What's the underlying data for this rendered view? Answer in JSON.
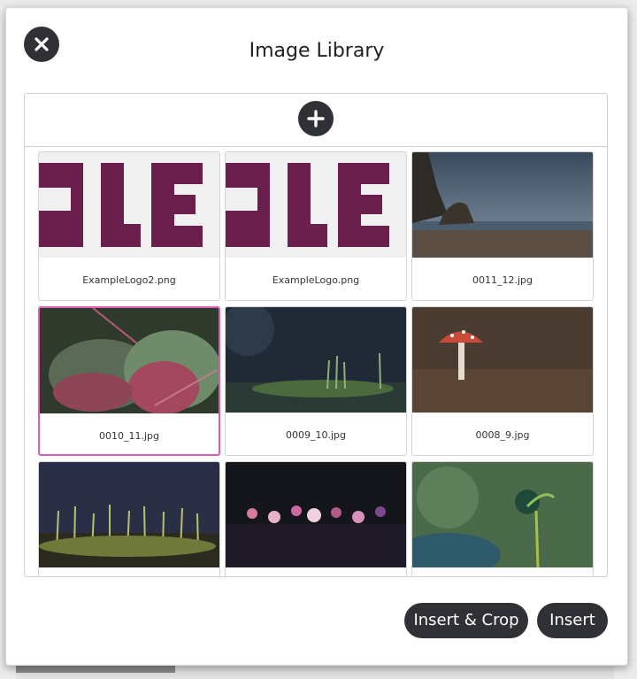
{
  "modal": {
    "title": "Image Library",
    "close_icon": "close-icon",
    "add_icon": "plus-icon",
    "accent": "#e05bb7"
  },
  "images": [
    {
      "filename": "ExampleLogo2.png",
      "selected": false
    },
    {
      "filename": "ExampleLogo.png",
      "selected": false
    },
    {
      "filename": "0011_12.jpg",
      "selected": false
    },
    {
      "filename": "0010_11.jpg",
      "selected": true
    },
    {
      "filename": "0009_10.jpg",
      "selected": false
    },
    {
      "filename": "0008_9.jpg",
      "selected": false
    },
    {
      "filename": "",
      "selected": false
    },
    {
      "filename": "",
      "selected": false
    },
    {
      "filename": "",
      "selected": false
    }
  ],
  "actions": {
    "insert_crop_label": "Insert & Crop",
    "insert_label": "Insert"
  }
}
